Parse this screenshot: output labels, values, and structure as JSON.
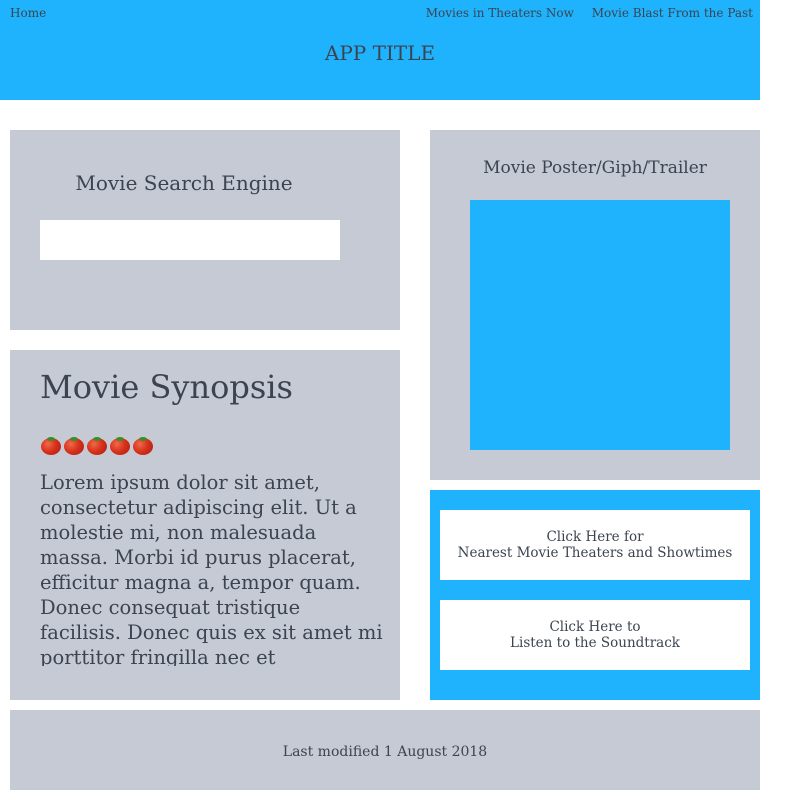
{
  "nav": {
    "home": "Home",
    "links": [
      "Movies in Theaters Now",
      "Movie Blast From the Past"
    ]
  },
  "header": {
    "title": "APP TITLE"
  },
  "search": {
    "title": "Movie Search Engine",
    "value": "",
    "placeholder": ""
  },
  "synopsis": {
    "title": "Movie Synopsis",
    "rating_count": 5,
    "rating_icon": "tomato-icon",
    "text": "Lorem ipsum dolor sit amet, consectetur adipiscing elit. Ut a molestie mi, non malesuada massa. Morbi id purus placerat, efficitur magna a, tempor quam. Donec consequat tristique facilisis. Donec quis ex sit amet mi porttitor fringilla nec et"
  },
  "poster": {
    "title": "Movie Poster/Giph/Trailer"
  },
  "links": {
    "theaters": {
      "line1": "Click Here for",
      "line2": "Nearest Movie Theaters and Showtimes"
    },
    "soundtrack": {
      "line1": "Click Here to",
      "line2": "Listen to the Soundtrack"
    }
  },
  "footer": {
    "text": "Last modified 1 August 2018"
  },
  "colors": {
    "accent": "#20b3fd",
    "panel": "#c5cad5",
    "text": "#3b4450",
    "background": "#ffffff"
  }
}
